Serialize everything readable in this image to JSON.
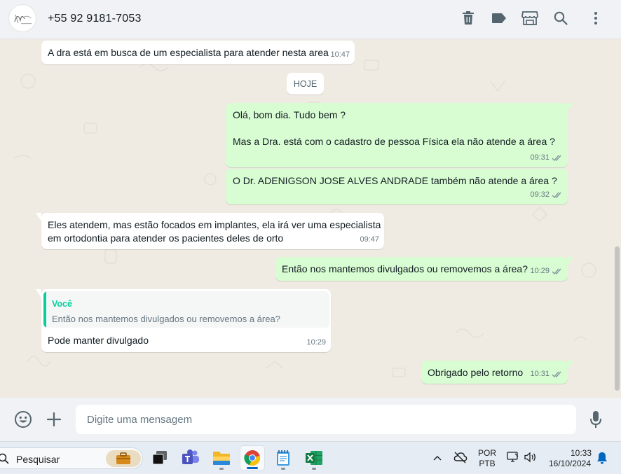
{
  "header": {
    "contact_name": "+55 92 9181-7053",
    "icons": [
      "delete-icon",
      "label-icon",
      "catalog-icon",
      "search-icon",
      "menu-icon"
    ]
  },
  "chat": {
    "date_divider": "HOJE",
    "messages": [
      {
        "direction": "in",
        "text": "A dra está em busca de um especialista para atender nesta area",
        "time": "10:47"
      },
      {
        "direction": "out",
        "lines": [
          "Olá, bom dia. Tudo bem ?",
          "Mas a Dra. está com o cadastro de pessoa Física ela não atende a área ?"
        ],
        "time": "09:31",
        "status": "read"
      },
      {
        "direction": "out",
        "text": "O Dr. ADENIGSON JOSE ALVES ANDRADE também não atende a área ?",
        "time": "09:32",
        "status": "read"
      },
      {
        "direction": "in",
        "lines": [
          "Eles atendem, mas estão focados em implantes, ela irá ver uma especialista",
          "em ortodontia para atender os pacientes deles de orto"
        ],
        "time": "09:47"
      },
      {
        "direction": "out",
        "text": "Então nos mantemos divulgados ou removemos a área?",
        "time": "10:29",
        "status": "read"
      },
      {
        "direction": "in",
        "quote": {
          "author": "Você",
          "text": "Então nos mantemos divulgados ou removemos a área?"
        },
        "text": "Pode manter divulgado",
        "time": "10:29"
      },
      {
        "direction": "out",
        "text": "Obrigado pelo retorno",
        "time": "10:31",
        "status": "read"
      }
    ]
  },
  "composer": {
    "placeholder": "Digite uma mensagem",
    "icons": [
      "emoji-icon",
      "attach-plus-icon",
      "microphone-icon"
    ]
  },
  "taskbar": {
    "search_label": "Pesquisar",
    "apps": [
      "work-briefcase-icon",
      "task-view-icon",
      "teams-icon",
      "file-explorer-icon",
      "chrome-icon",
      "notepad-icon",
      "excel-icon"
    ],
    "tray": {
      "lang_line1": "POR",
      "lang_line2": "PTB",
      "time": "10:33",
      "date": "16/10/2024"
    }
  },
  "colors": {
    "outgoing_bubble": "#d9fdd3",
    "incoming_bubble": "#ffffff",
    "chat_background": "#efeae2",
    "read_ticks": "#8696a0",
    "quote_accent": "#06cf9c"
  }
}
